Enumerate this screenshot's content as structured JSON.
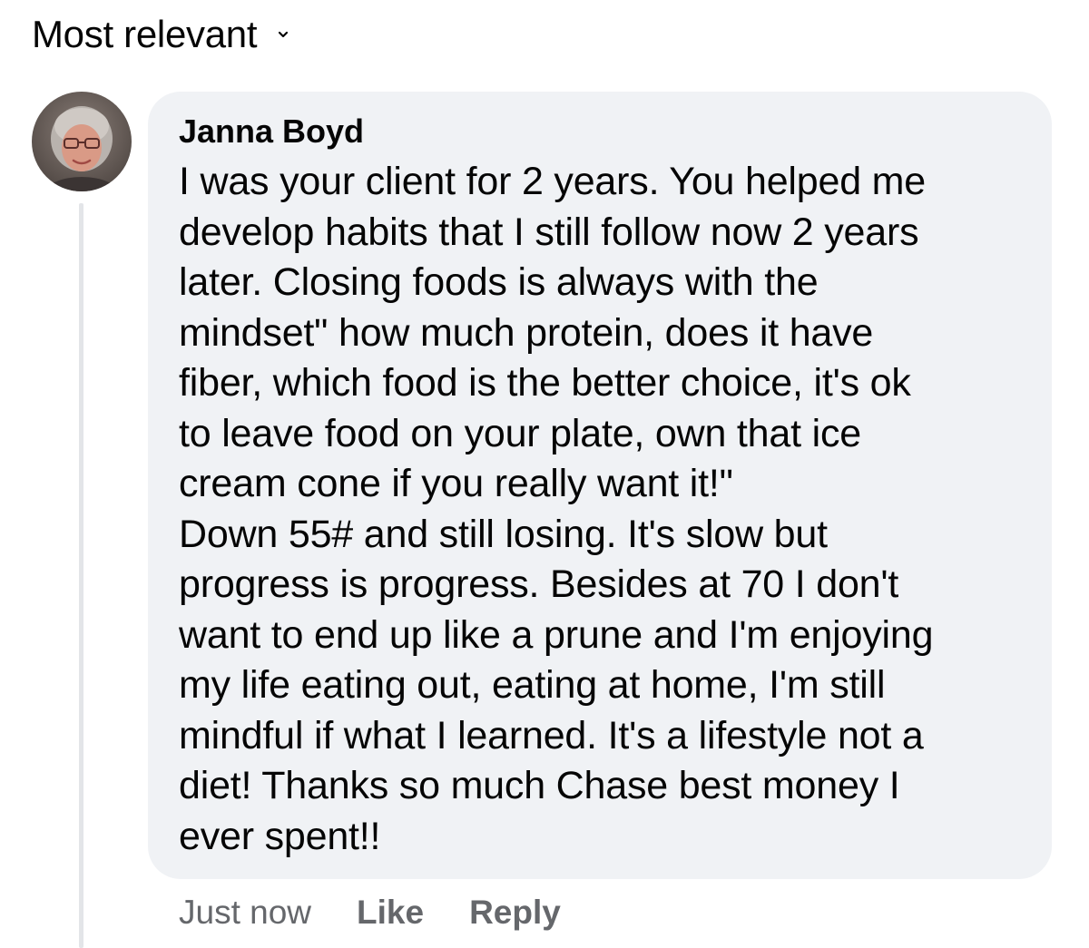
{
  "sort": {
    "label": "Most relevant",
    "icon": "chevron-down-icon"
  },
  "comment": {
    "author": "Janna Boyd",
    "avatar_icon": "user-avatar",
    "lines": [
      "I was your client for 2 years. You helped me",
      "develop habits that I still follow now 2 years",
      "later. Closing foods is always with the",
      "mindset\" how much protein, does it have",
      "fiber, which food is the better choice, it's ok",
      "to leave food on your plate, own that ice",
      "cream cone if you really want it!\"",
      "Down 55# and still losing. It's slow but",
      "progress is progress. Besides at 70 I don't",
      "want to end up like a prune and I'm enjoying",
      "my life eating out, eating at home, I'm still",
      "mindful if what I learned. It's a lifestyle not a",
      "diet! Thanks so much Chase best money I",
      "ever spent!!"
    ],
    "timestamp": "Just now",
    "like_label": "Like",
    "reply_label": "Reply"
  },
  "colors": {
    "bubble_bg": "#f0f2f5",
    "text": "#050505",
    "secondary_text": "#65676b"
  }
}
